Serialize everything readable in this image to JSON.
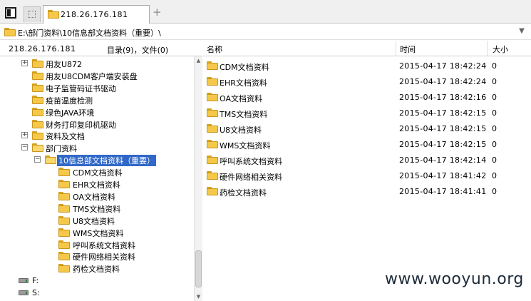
{
  "tabs": {
    "active_label": "218.26.176.181",
    "new_tab_symbol": "+"
  },
  "pathbar": {
    "path": "E:\\部门资料\\10信息部文档资料（重要）\\"
  },
  "left": {
    "host": "218.26.176.181",
    "count": "目录(9)，文件(0)",
    "tree": [
      {
        "label": "用友U872",
        "expander": "+",
        "level": 1
      },
      {
        "label": "用友U8CDM客户端安装盘",
        "expander": "",
        "level": 1
      },
      {
        "label": "电子监管码证书驱动",
        "expander": "",
        "level": 1
      },
      {
        "label": "疫苗温度检测",
        "expander": "",
        "level": 1
      },
      {
        "label": "绿色JAVA环境",
        "expander": "",
        "level": 1
      },
      {
        "label": "财务打印复印机驱动",
        "expander": "",
        "level": 1
      },
      {
        "label": "资料及文档",
        "expander": "+",
        "level": 1
      },
      {
        "label": "部门资料",
        "expander": "−",
        "level": 1
      },
      {
        "label": "10信息部文档资料（重要）",
        "expander": "−",
        "level": 2,
        "selected": true
      },
      {
        "label": "CDM文档资料",
        "expander": "",
        "level": 3
      },
      {
        "label": "EHR文档资料",
        "expander": "",
        "level": 3
      },
      {
        "label": "OA文档资料",
        "expander": "",
        "level": 3
      },
      {
        "label": "TMS文档资料",
        "expander": "",
        "level": 3
      },
      {
        "label": "U8文档资料",
        "expander": "",
        "level": 3
      },
      {
        "label": "WMS文档资料",
        "expander": "",
        "level": 3
      },
      {
        "label": "呼叫系统文档资料",
        "expander": "",
        "level": 3
      },
      {
        "label": "硬件网络相关资料",
        "expander": "",
        "level": 3
      },
      {
        "label": "药检文档资料",
        "expander": "",
        "level": 3
      }
    ],
    "drives": [
      {
        "label": "F:"
      },
      {
        "label": "S:"
      }
    ]
  },
  "right": {
    "columns": {
      "name": "名称",
      "time": "时间",
      "size": "大小"
    },
    "files": [
      {
        "name": "CDM文档资料",
        "time": "2015-04-17 18:42:24",
        "size": "0"
      },
      {
        "name": "EHR文档资料",
        "time": "2015-04-17 18:42:24",
        "size": "0"
      },
      {
        "name": "OA文档资料",
        "time": "2015-04-17 18:42:16",
        "size": "0"
      },
      {
        "name": "TMS文档资料",
        "time": "2015-04-17 18:42:15",
        "size": "0"
      },
      {
        "name": "U8文档资料",
        "time": "2015-04-17 18:42:15",
        "size": "0"
      },
      {
        "name": "WMS文档资料",
        "time": "2015-04-17 18:42:15",
        "size": "0"
      },
      {
        "name": "呼叫系统文档资料",
        "time": "2015-04-17 18:42:14",
        "size": "0"
      },
      {
        "name": "硬件网络相关资料",
        "time": "2015-04-17 18:41:42",
        "size": "0"
      },
      {
        "name": "药检文档资料",
        "time": "2015-04-17 18:41:41",
        "size": "0"
      }
    ]
  },
  "watermark": "www.wooyun.org",
  "colors": {
    "selection": "#3168c8",
    "folder": "#f5c84a"
  }
}
